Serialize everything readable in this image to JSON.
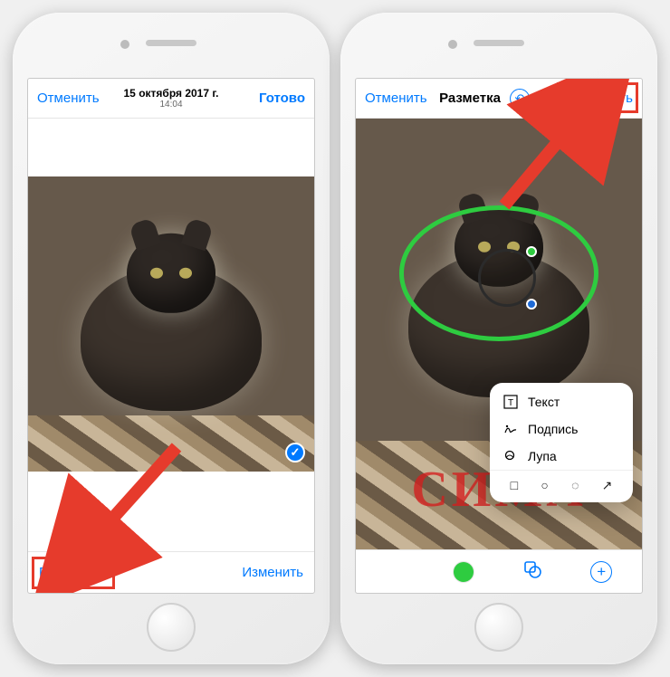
{
  "left": {
    "cancel": "Отменить",
    "date": "15 октября 2017 г.",
    "time": "14:04",
    "done": "Готово",
    "markup": "Разметка",
    "edit": "Изменить",
    "check_glyph": "✓"
  },
  "right": {
    "cancel": "Отменить",
    "title": "Разметка",
    "undo_glyph": "↶",
    "redo_glyph": "↷",
    "save": "Сохранить",
    "handwriting": "СИМА",
    "popup": {
      "text": "Текст",
      "signature": "Подпись",
      "loupe": "Лупа",
      "shapes": {
        "square": "□",
        "circle": "○",
        "bubble": "◌",
        "arrow": "↗"
      }
    },
    "toolbar": {
      "plus": "+"
    }
  },
  "colors": {
    "ios_blue": "#007aff",
    "highlight_red": "#e63b2c",
    "marker_green": "#2ecc40"
  }
}
